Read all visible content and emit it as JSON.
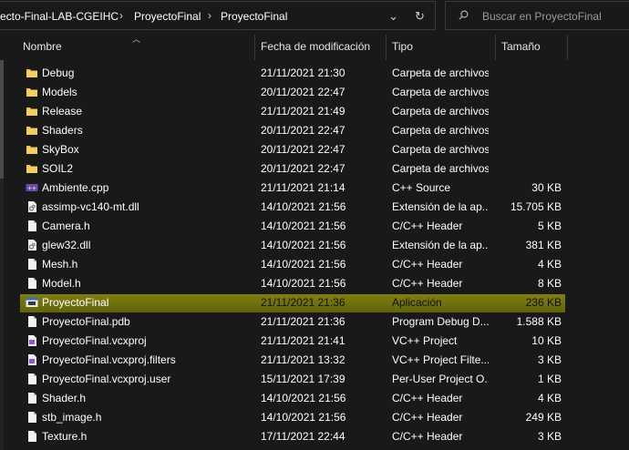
{
  "breadcrumb": {
    "segments": [
      "ecto-Final-LAB-CGEIHC",
      "ProyectoFinal",
      "ProyectoFinal"
    ]
  },
  "search": {
    "placeholder": "Buscar en ProyectoFinal"
  },
  "columns": {
    "name": "Nombre",
    "date": "Fecha de modificación",
    "type": "Tipo",
    "size": "Tamaño"
  },
  "colors": {
    "background": "#191919",
    "folder": "#e8c25a",
    "selection": "#7c7c0e"
  },
  "files": [
    {
      "name": "Debug",
      "date": "21/11/2021 21:30",
      "type": "Carpeta de archivos",
      "size": "",
      "icon": "folder-icon"
    },
    {
      "name": "Models",
      "date": "20/11/2021 22:47",
      "type": "Carpeta de archivos",
      "size": "",
      "icon": "folder-icon"
    },
    {
      "name": "Release",
      "date": "21/11/2021 21:49",
      "type": "Carpeta de archivos",
      "size": "",
      "icon": "folder-icon"
    },
    {
      "name": "Shaders",
      "date": "20/11/2021 22:47",
      "type": "Carpeta de archivos",
      "size": "",
      "icon": "folder-icon"
    },
    {
      "name": "SkyBox",
      "date": "20/11/2021 22:47",
      "type": "Carpeta de archivos",
      "size": "",
      "icon": "folder-icon"
    },
    {
      "name": "SOIL2",
      "date": "20/11/2021 22:47",
      "type": "Carpeta de archivos",
      "size": "",
      "icon": "folder-icon"
    },
    {
      "name": "Ambiente.cpp",
      "date": "21/11/2021 21:14",
      "type": "C++ Source",
      "size": "30 KB",
      "icon": "cpp-source-icon"
    },
    {
      "name": "assimp-vc140-mt.dll",
      "date": "14/10/2021 21:56",
      "type": "Extensión de la ap...",
      "size": "15.705 KB",
      "icon": "dll-icon"
    },
    {
      "name": "Camera.h",
      "date": "14/10/2021 21:56",
      "type": "C/C++ Header",
      "size": "5 KB",
      "icon": "file-icon"
    },
    {
      "name": "glew32.dll",
      "date": "14/10/2021 21:56",
      "type": "Extensión de la ap...",
      "size": "381 KB",
      "icon": "dll-icon"
    },
    {
      "name": "Mesh.h",
      "date": "14/10/2021 21:56",
      "type": "C/C++ Header",
      "size": "4 KB",
      "icon": "file-icon"
    },
    {
      "name": "Model.h",
      "date": "14/10/2021 21:56",
      "type": "C/C++ Header",
      "size": "8 KB",
      "icon": "file-icon"
    },
    {
      "name": "ProyectoFinal",
      "date": "21/11/2021 21:36",
      "type": "Aplicación",
      "size": "236 KB",
      "icon": "exe-icon",
      "selected": true
    },
    {
      "name": "ProyectoFinal.pdb",
      "date": "21/11/2021 21:36",
      "type": "Program Debug D...",
      "size": "1.588 KB",
      "icon": "file-icon"
    },
    {
      "name": "ProyectoFinal.vcxproj",
      "date": "21/11/2021 21:41",
      "type": "VC++ Project",
      "size": "10 KB",
      "icon": "vcxproj-icon"
    },
    {
      "name": "ProyectoFinal.vcxproj.filters",
      "date": "21/11/2021 13:32",
      "type": "VC++ Project Filte...",
      "size": "3 KB",
      "icon": "vcxproj-icon"
    },
    {
      "name": "ProyectoFinal.vcxproj.user",
      "date": "15/11/2021 17:39",
      "type": "Per-User Project O...",
      "size": "1 KB",
      "icon": "file-icon"
    },
    {
      "name": "Shader.h",
      "date": "14/10/2021 21:56",
      "type": "C/C++ Header",
      "size": "4 KB",
      "icon": "file-icon"
    },
    {
      "name": "stb_image.h",
      "date": "14/10/2021 21:56",
      "type": "C/C++ Header",
      "size": "249 KB",
      "icon": "file-icon"
    },
    {
      "name": "Texture.h",
      "date": "17/11/2021 22:44",
      "type": "C/C++ Header",
      "size": "3 KB",
      "icon": "file-icon"
    }
  ]
}
